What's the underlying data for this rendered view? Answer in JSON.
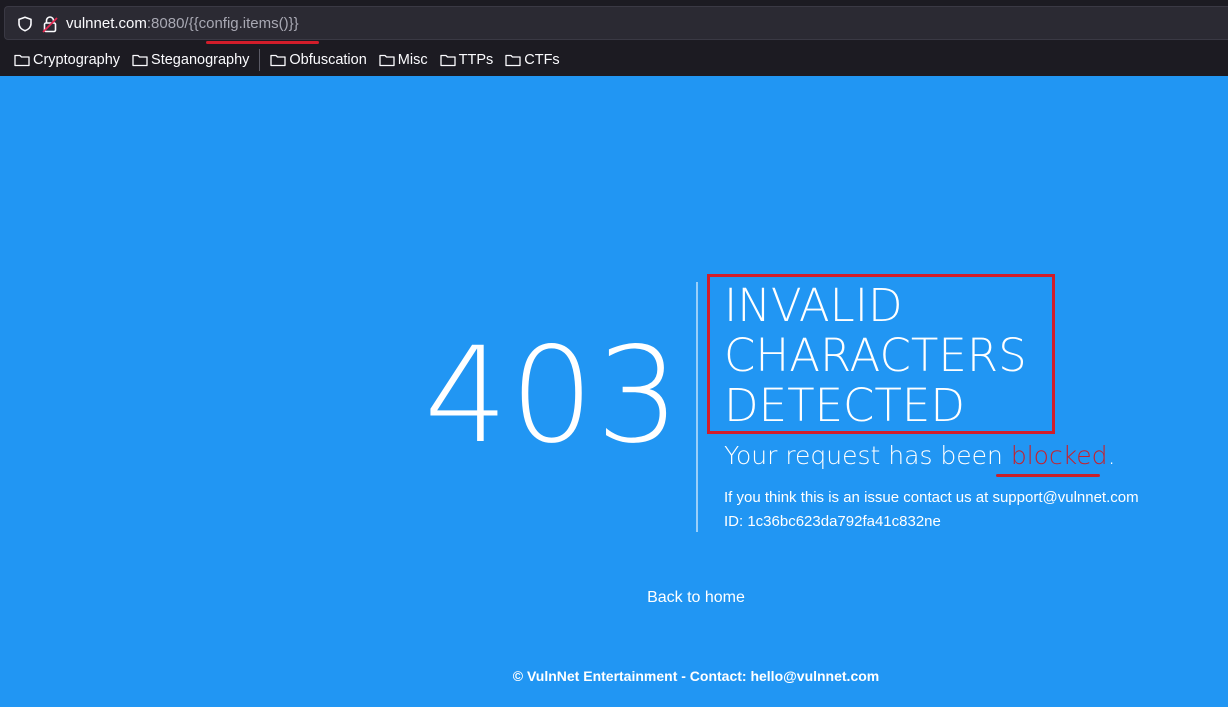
{
  "browser": {
    "url_host": "vulnnet.com",
    "url_rest": ":8080/{{config.items()}}",
    "bookmarks_left": [
      {
        "label": "Cryptography"
      },
      {
        "label": "Steganography"
      }
    ],
    "bookmarks_right": [
      {
        "label": "Obfuscation"
      },
      {
        "label": "Misc"
      },
      {
        "label": "TTPs"
      },
      {
        "label": "CTFs"
      }
    ]
  },
  "page": {
    "code": "403",
    "title_lines": [
      "INVALID",
      "CHARACTERS",
      "DETECTED"
    ],
    "subtitle_prefix": "Your request has been ",
    "subtitle_highlight": "blocked",
    "subtitle_suffix": ".",
    "info_line": "If you think this is an issue contact us at support@vulnnet.com",
    "id_line": "ID: 1c36bc623da792fa41c832ne",
    "back_link": "Back to home",
    "footer": "© VulnNet Entertainment - Contact: hello@vulnnet.com"
  },
  "colors": {
    "background": "#2196f3",
    "annotation_red": "#d21d2a"
  }
}
